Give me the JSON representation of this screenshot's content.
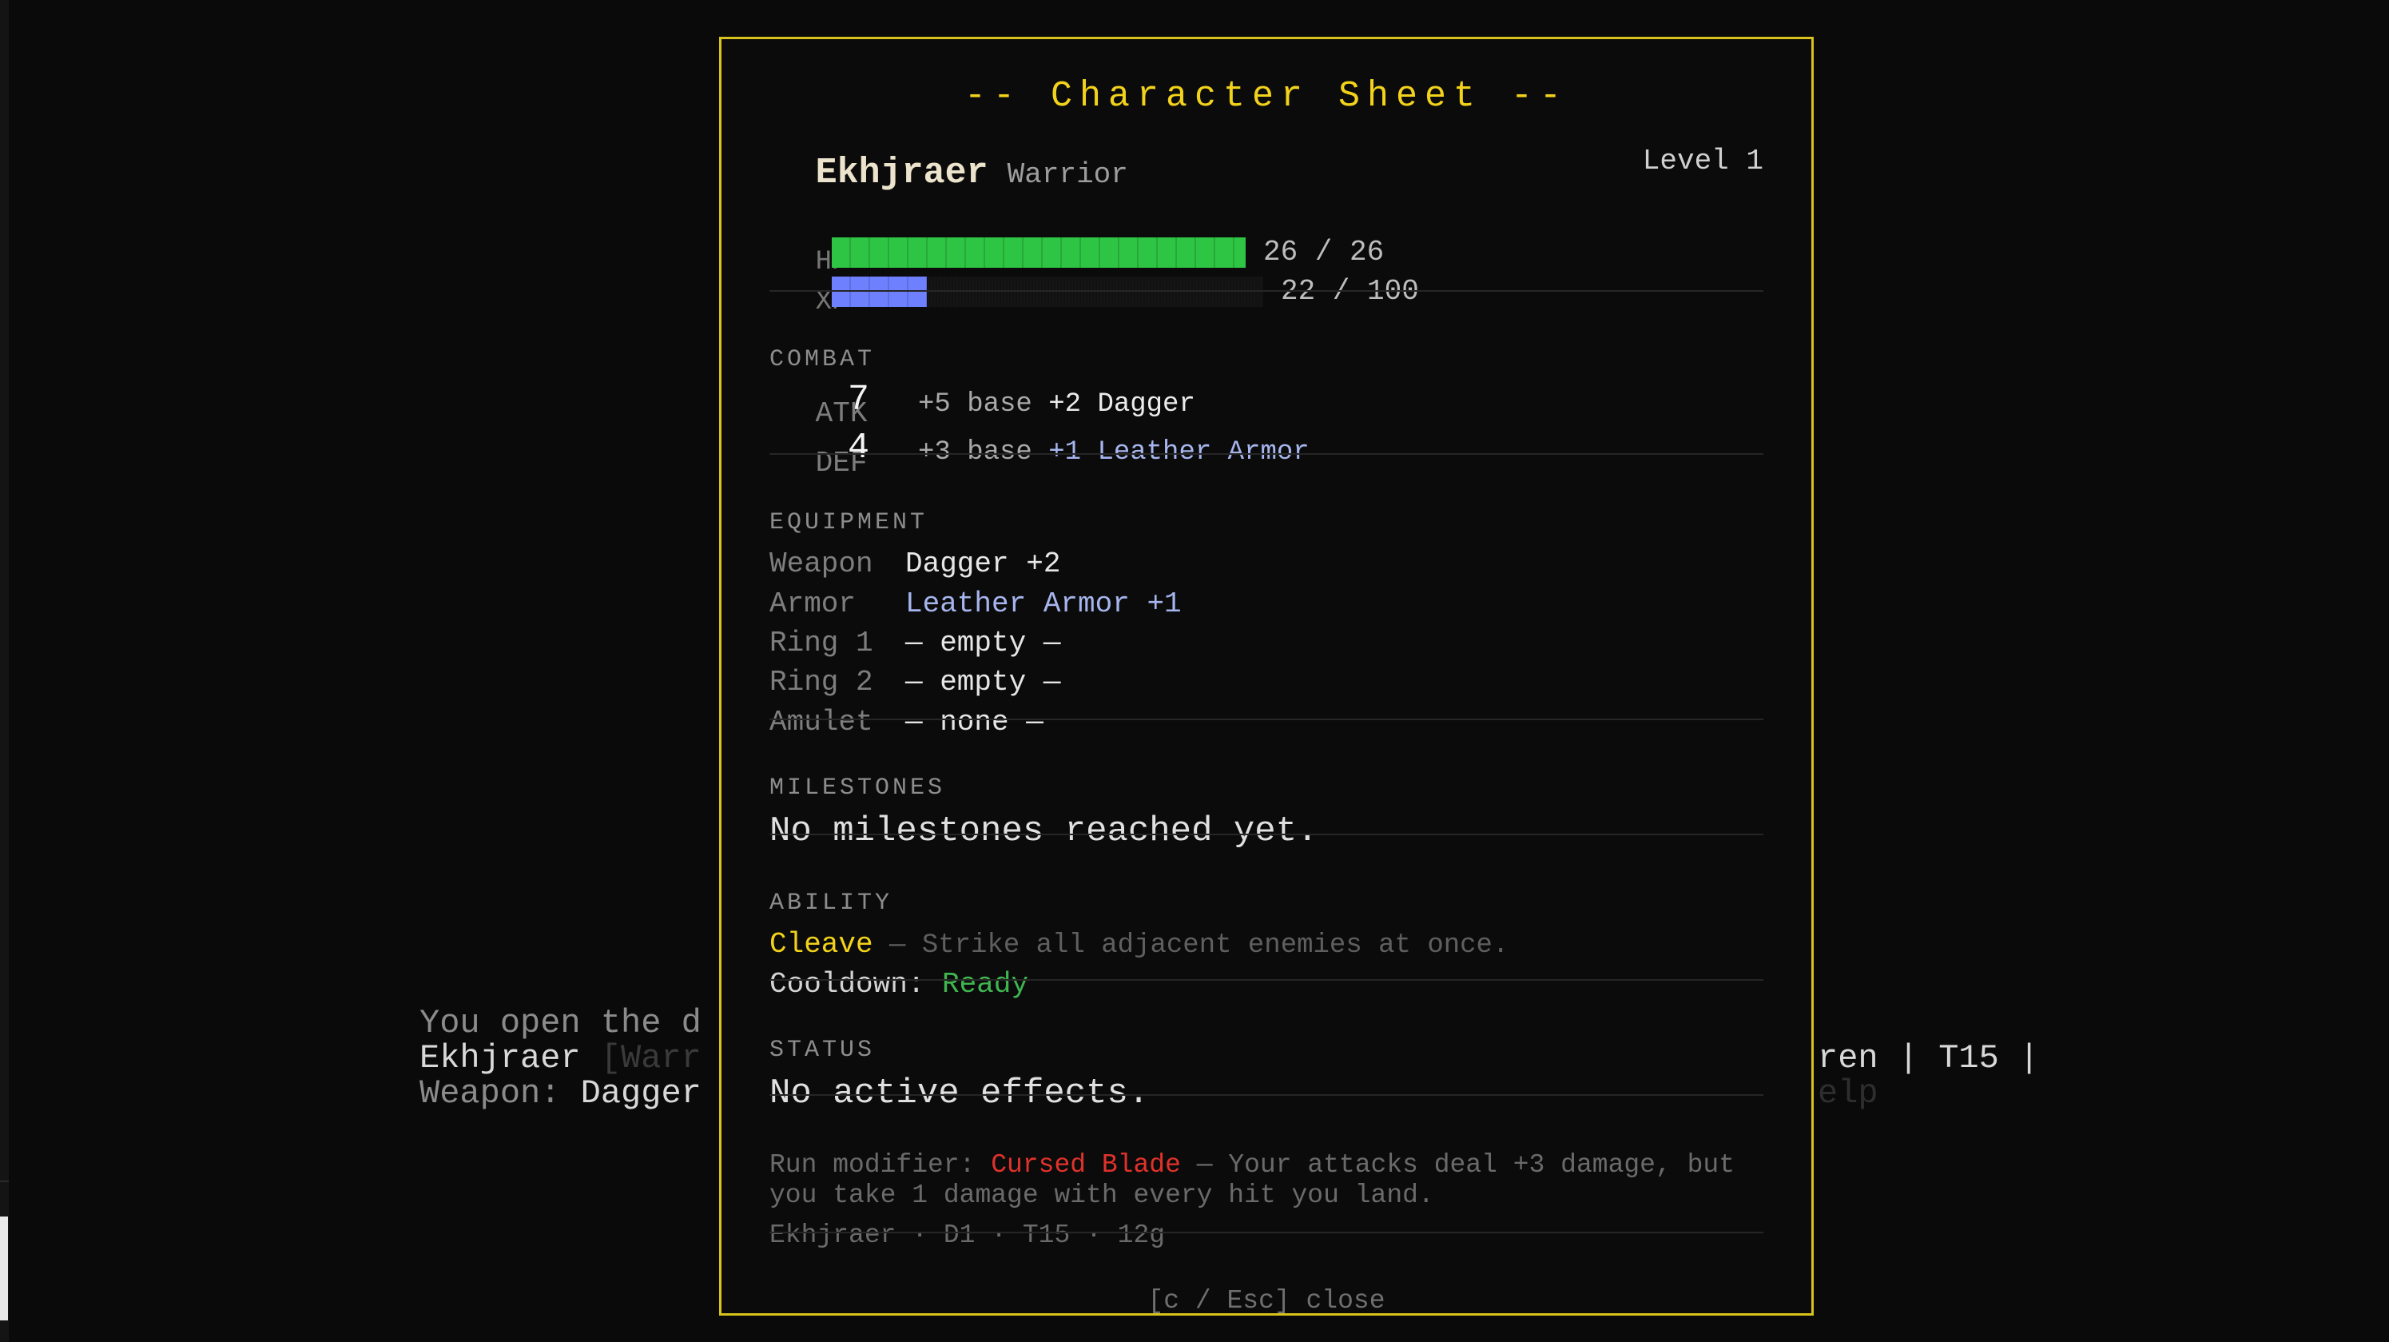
{
  "background": {
    "log_line1": "You open the d",
    "log_line2_name": "Ekhjraer",
    "log_line2_rest": " [Warr",
    "log_line3_label": "Weapon: ",
    "log_line3_value": "Dagger",
    "right_line2": "ren | T15 |",
    "right_line3": "elp"
  },
  "sheet": {
    "title": "-- Character Sheet --",
    "name": "Ekhjraer",
    "class": "Warrior",
    "level": "Level 1",
    "hp": {
      "label": "HP",
      "current": 26,
      "max": 26,
      "text": "26 / 26",
      "color": "#2fc544"
    },
    "xp": {
      "label": "XP",
      "current": 22,
      "max": 100,
      "text": "22 / 100",
      "color": "#6f80ff"
    },
    "combat": {
      "heading": "COMBAT",
      "atk": {
        "label": "ATK",
        "value": "7",
        "base": "+5 base",
        "bonus": "+2 Dagger"
      },
      "def": {
        "label": "DEF",
        "value": "4",
        "base": "+3 base",
        "bonus": "+1 Leather Armor"
      }
    },
    "equipment": {
      "heading": "EQUIPMENT",
      "items": [
        {
          "label": "Weapon",
          "value": "Dagger +2"
        },
        {
          "label": "Armor",
          "value": "Leather Armor +1"
        },
        {
          "label": "Ring 1",
          "value": "— empty —"
        },
        {
          "label": "Ring 2",
          "value": "— empty —"
        },
        {
          "label": "Amulet",
          "value": "— none —"
        }
      ]
    },
    "milestones": {
      "heading": "MILESTONES",
      "text": "No milestones reached yet."
    },
    "ability": {
      "heading": "ABILITY",
      "name": "Cleave",
      "description": " — Strike all adjacent enemies at once.",
      "cooldown_label": "Cooldown: ",
      "cooldown_value": "Ready"
    },
    "status": {
      "heading": "STATUS",
      "text": "No active effects."
    },
    "run_modifier": {
      "label": "Run modifier: ",
      "name": "Cursed Blade",
      "description": " — Your attacks deal +3 damage, but you take 1 damage with every hit you land."
    },
    "footer_summary": "Ekhjraer · D1 · T15 · 12g",
    "close_hint": "[c / Esc] close",
    "accent_color": "#f2d21a"
  }
}
